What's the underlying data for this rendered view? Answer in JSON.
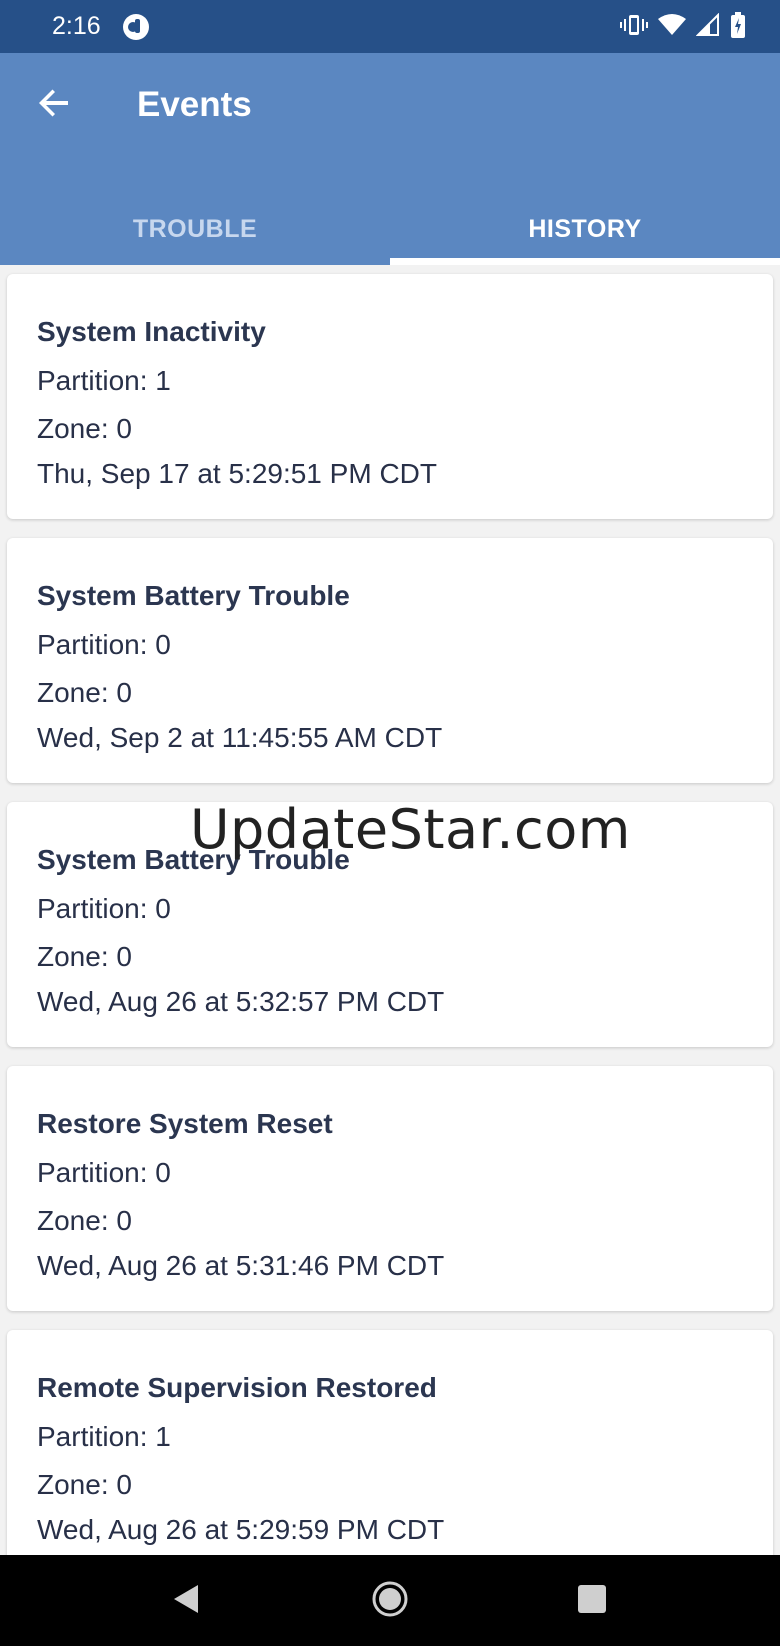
{
  "status_bar": {
    "time": "2:16"
  },
  "app_bar": {
    "title": "Events",
    "tabs": [
      {
        "label": "TROUBLE",
        "active": false
      },
      {
        "label": "HISTORY",
        "active": true
      }
    ]
  },
  "events": [
    {
      "title": "System Inactivity",
      "partition": "Partition: 1",
      "zone": "Zone: 0",
      "timestamp": "Thu, Sep 17 at 5:29:51 PM CDT"
    },
    {
      "title": "System Battery Trouble",
      "partition": "Partition: 0",
      "zone": "Zone: 0",
      "timestamp": "Wed, Sep 2 at 11:45:55 AM CDT"
    },
    {
      "title": "System Battery Trouble",
      "partition": "Partition: 0",
      "zone": "Zone: 0",
      "timestamp": "Wed, Aug 26 at 5:32:57 PM CDT"
    },
    {
      "title": "Restore System Reset",
      "partition": "Partition: 0",
      "zone": "Zone: 0",
      "timestamp": "Wed, Aug 26 at 5:31:46 PM CDT"
    },
    {
      "title": "Remote Supervision Restored",
      "partition": "Partition: 1",
      "zone": "Zone: 0",
      "timestamp": "Wed, Aug 26 at 5:29:59 PM CDT"
    }
  ],
  "watermark": "UpdateStar.com",
  "icons": {
    "back": "arrow-back-icon",
    "vibrate": "vibrate-icon",
    "wifi": "wifi-icon",
    "signal": "signal-icon",
    "battery": "battery-icon",
    "nav_back": "nav-back-icon",
    "nav_home": "nav-home-icon",
    "nav_recents": "nav-recents-icon"
  },
  "colors": {
    "status_bar": "#265088",
    "app_bar": "#5b87c1",
    "title_text": "#2b3650"
  }
}
